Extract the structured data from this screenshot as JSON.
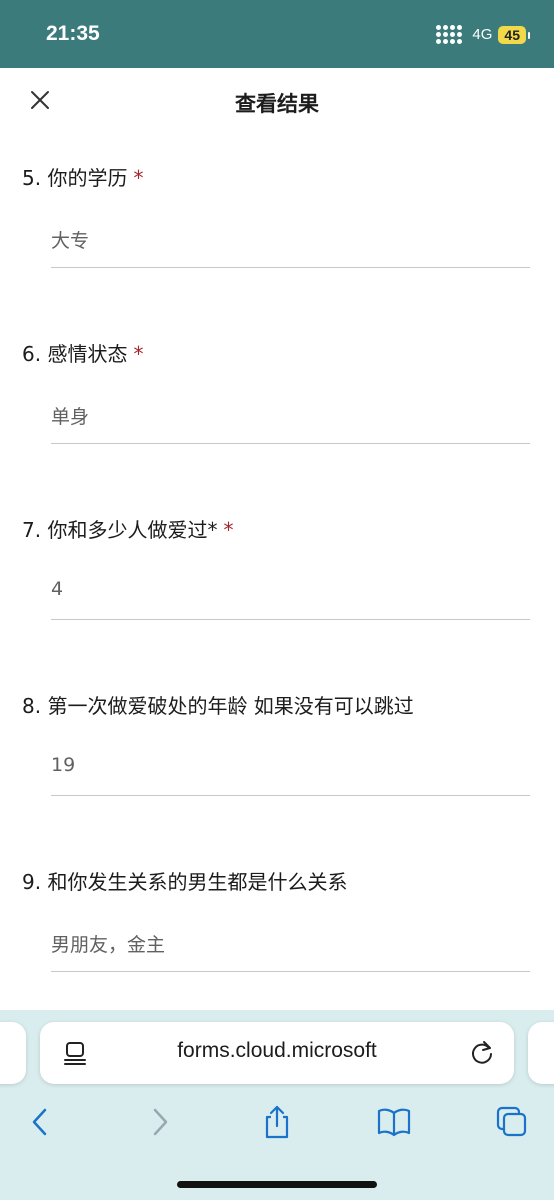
{
  "status_bar": {
    "time": "21:35",
    "network": "4G",
    "battery": "45"
  },
  "header": {
    "title": "查看结果"
  },
  "questions": [
    {
      "number": "5.",
      "label": "你的学历",
      "required_mark": "*",
      "answer": "大专"
    },
    {
      "number": "6.",
      "label": "感情状态",
      "required_mark": "*",
      "answer": "单身"
    },
    {
      "number": "7.",
      "label": "你和多少人做爱过*",
      "required_mark": "*",
      "answer": "4"
    },
    {
      "number": "8.",
      "label": "第一次做爱破处的年龄 如果没有可以跳过",
      "required_mark": "",
      "answer": "19"
    },
    {
      "number": "9.",
      "label": "和你发生关系的男生都是什么关系",
      "required_mark": "",
      "answer": "男朋友，金主"
    }
  ],
  "browser": {
    "url": "forms.cloud.microsoft"
  },
  "colors": {
    "status_bar_bg": "#3b7b7c",
    "required_mark": "#a4262c",
    "toolbar_bg": "#d9edef",
    "toolbar_icon": "#1a73c8"
  }
}
